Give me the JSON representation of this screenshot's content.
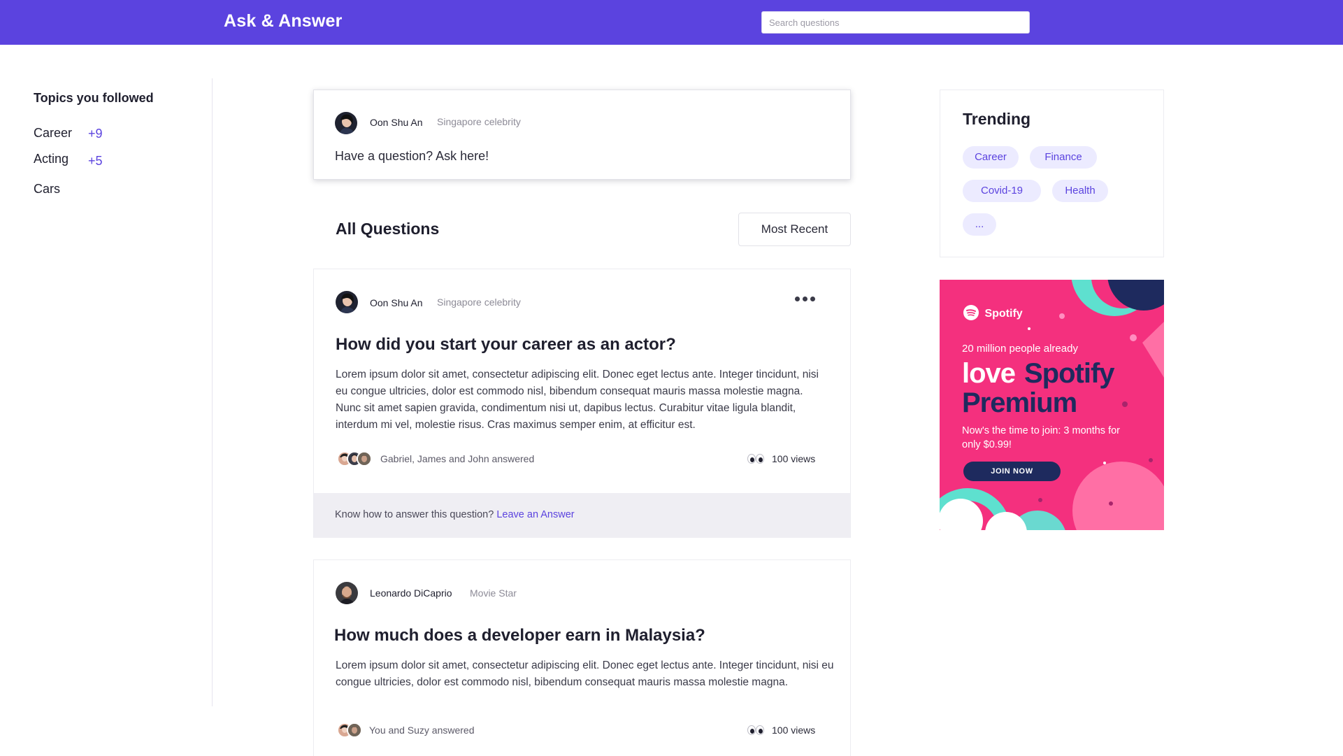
{
  "app": {
    "title": "Ask & Answer",
    "accent": "#5b43df"
  },
  "search": {
    "placeholder": "Search questions",
    "value": ""
  },
  "sidebar": {
    "title": "Topics you followed",
    "topics": [
      {
        "label": "Career",
        "badge": "+9"
      },
      {
        "label": "Acting",
        "badge": "+5"
      },
      {
        "label": "Cars",
        "badge": ""
      }
    ]
  },
  "composer": {
    "author": "Oon Shu An",
    "role": "Singapore celebrity",
    "prompt": "Have a question? Ask here!"
  },
  "questions_header": {
    "title": "All Questions",
    "sort_label": "Most Recent"
  },
  "questions": [
    {
      "author": "Oon Shu An",
      "role": "Singapore celebrity",
      "title": "How did you start your career as an actor?",
      "body": "Lorem ipsum dolor sit amet, consectetur adipiscing elit. Donec eget lectus ante. Integer tincidunt, nisi eu congue ultricies, dolor est commodo nisl, bibendum consequat mauris massa molestie magna. Nunc sit amet sapien gravida, condimentum nisi ut, dapibus lectus. Curabitur vitae ligula blandit, interdum mi vel, molestie risus. Cras maximus semper enim, at efficitur est.",
      "answered": "Gabriel, James and John answered",
      "views": "100 views",
      "answer_prompt": "Know how to answer this question?",
      "answer_link": "Leave an Answer"
    },
    {
      "author": "Leonardo DiCaprio",
      "role": "Movie Star",
      "title": "How much does a developer earn in Malaysia?",
      "body": "Lorem ipsum dolor sit amet, consectetur adipiscing elit. Donec eget lectus ante. Integer tincidunt, nisi eu congue ultricies, dolor est commodo nisl, bibendum consequat mauris massa molestie magna.",
      "answered": "You and Suzy answered",
      "views": "100 views"
    }
  ],
  "trending": {
    "title": "Trending",
    "tags": [
      "Career",
      "Finance",
      "Covid-19",
      "Health",
      "..."
    ]
  },
  "ad": {
    "brand": "Spotify",
    "line1": "20 million people already",
    "headline_a": "love",
    "headline_b": "Spotify",
    "headline_c": "Premium",
    "subline": "Now's the time to join: 3 months for only $0.99!",
    "cta": "JOIN NOW",
    "bg_color": "#f4307e",
    "navy_color": "#1e2a5e"
  }
}
